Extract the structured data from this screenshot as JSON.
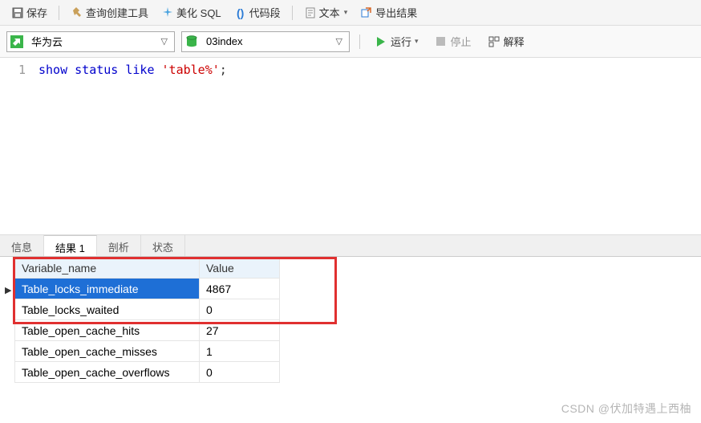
{
  "toolbar": {
    "save": "保存",
    "query_builder": "查询创建工具",
    "beautify": "美化 SQL",
    "snippets": "代码段",
    "text": "文本",
    "export": "导出结果"
  },
  "connection": {
    "selected": "华为云"
  },
  "database": {
    "selected": "03index"
  },
  "actions": {
    "run": "运行",
    "stop": "停止",
    "explain": "解释"
  },
  "editor": {
    "line_no": "1",
    "kw_show": "show",
    "kw_status": "status",
    "kw_like": "like",
    "string": "'table%'",
    "semicolon": ";"
  },
  "tabs": {
    "info": "信息",
    "result": "结果 1",
    "profile": "剖析",
    "status": "状态"
  },
  "grid": {
    "col_name": "Variable_name",
    "col_value": "Value",
    "rows": [
      {
        "name": "Table_locks_immediate",
        "value": "4867"
      },
      {
        "name": "Table_locks_waited",
        "value": "0"
      },
      {
        "name": "Table_open_cache_hits",
        "value": "27"
      },
      {
        "name": "Table_open_cache_misses",
        "value": "1"
      },
      {
        "name": "Table_open_cache_overflows",
        "value": "0"
      }
    ]
  },
  "watermark": "CSDN @伏加特遇上西柚",
  "chart_data": {
    "type": "table",
    "title": "show status like 'table%'",
    "columns": [
      "Variable_name",
      "Value"
    ],
    "rows": [
      [
        "Table_locks_immediate",
        4867
      ],
      [
        "Table_locks_waited",
        0
      ],
      [
        "Table_open_cache_hits",
        27
      ],
      [
        "Table_open_cache_misses",
        1
      ],
      [
        "Table_open_cache_overflows",
        0
      ]
    ]
  }
}
